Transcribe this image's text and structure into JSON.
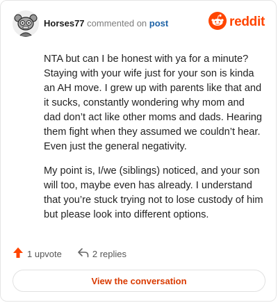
{
  "header": {
    "username": "Horses77",
    "verb": "commented on",
    "post_link": "post",
    "brand": "reddit"
  },
  "comment": {
    "paragraphs": [
      "NTA but can I be honest with ya for a minute? Staying with your wife just for your son is kinda an AH move. I grew up with parents like that and it sucks, constantly wondering why mom and dad don’t act like other moms and dads. Hearing them fight when they assumed we couldn’t hear. Even just the general negativity.",
      "My point is, I/we (siblings) noticed, and your son will too, maybe even has already. I understand that you’re stuck trying not to lose custody of him but please look into different options."
    ]
  },
  "actions": {
    "upvote_label": "1 upvote",
    "replies_label": "2 replies"
  },
  "cta": {
    "label": "View the conversation"
  },
  "colors": {
    "brand_orange": "#ff4500",
    "link_blue": "#1d62a6",
    "cta_text": "#d93a00"
  },
  "icons": {
    "avatar": "snoo-avatar-icon",
    "brand": "reddit-logo-icon",
    "upvote": "upvote-arrow-icon",
    "reply": "reply-arrow-icon"
  }
}
